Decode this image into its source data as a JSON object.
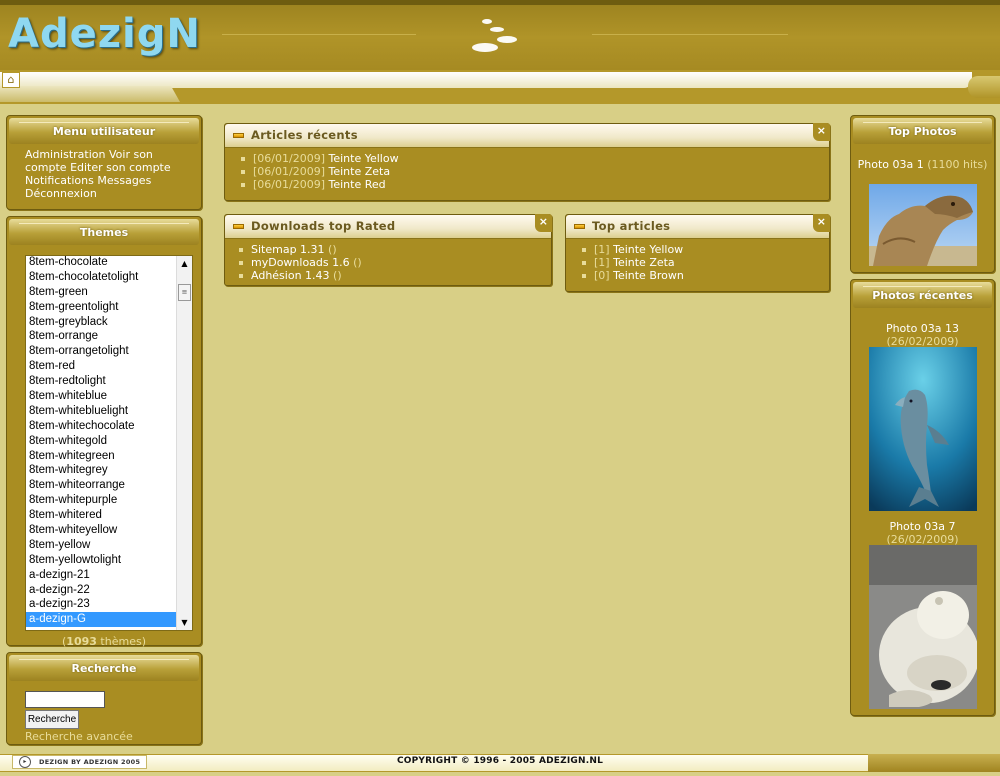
{
  "header": {
    "logo": "AdezigN"
  },
  "user_menu": {
    "title": "Menu utilisateur",
    "links": [
      "Administration",
      "Voir son compte",
      "Editer son compte",
      "Notifications",
      "Messages",
      "Déconnexion"
    ]
  },
  "themes": {
    "title": "Themes",
    "items": [
      "8tem-chocolate",
      "8tem-chocolatetolight",
      "8tem-green",
      "8tem-greentolight",
      "8tem-greyblack",
      "8tem-orrange",
      "8tem-orrangetolight",
      "8tem-red",
      "8tem-redtolight",
      "8tem-whiteblue",
      "8tem-whitebluelight",
      "8tem-whitechocolate",
      "8tem-whitegold",
      "8tem-whitegreen",
      "8tem-whitegrey",
      "8tem-whiteorrange",
      "8tem-whitepurple",
      "8tem-whitered",
      "8tem-whiteyellow",
      "8tem-yellow",
      "8tem-yellowtolight",
      "a-dezign-21",
      "a-dezign-22",
      "a-dezign-23",
      "a-dezign-G"
    ],
    "selected": "a-dezign-G",
    "count_number": "1093",
    "count_label": "thèmes"
  },
  "search": {
    "title": "Recherche",
    "button": "Recherche",
    "advanced": "Recherche avancée"
  },
  "articles_recents": {
    "title": "Articles récents",
    "close": "×",
    "items": [
      {
        "date": "[06/01/2009]",
        "name": "Teinte Yellow"
      },
      {
        "date": "[06/01/2009]",
        "name": "Teinte Zeta"
      },
      {
        "date": "[06/01/2009]",
        "name": "Teinte Red"
      }
    ]
  },
  "downloads": {
    "title": "Downloads top Rated",
    "close": "×",
    "items": [
      {
        "name": "Sitemap 1.31",
        "rating": "()"
      },
      {
        "name": "myDownloads 1.6",
        "rating": "()"
      },
      {
        "name": "Adhésion 1.43",
        "rating": "()"
      }
    ]
  },
  "top_articles": {
    "title": "Top articles",
    "close": "×",
    "items": [
      {
        "count": "[1]",
        "name": "Teinte Yellow"
      },
      {
        "count": "[1]",
        "name": "Teinte Zeta"
      },
      {
        "count": "[0]",
        "name": "Teinte Brown"
      }
    ]
  },
  "top_photos": {
    "title": "Top Photos",
    "photo": {
      "caption": "Photo 03a 1",
      "hits": "(1100 hits)"
    }
  },
  "recent_photos": {
    "title": "Photos récentes",
    "photos": [
      {
        "caption": "Photo 03a 13",
        "date": "(26/02/2009)"
      },
      {
        "caption": "Photo 03a 7",
        "date": "(26/02/2009)"
      }
    ]
  },
  "footer": {
    "left": "DEZIGN BY ADEZIGN 2005",
    "copyright": "COPYRIGHT © 1996 - 2005 ADEZIGN.NL"
  },
  "colors": {
    "background": "#d8cf86",
    "header": "#a98d22",
    "block_title_bar": "#f0e8c8",
    "selected_item": "#3399ff"
  }
}
